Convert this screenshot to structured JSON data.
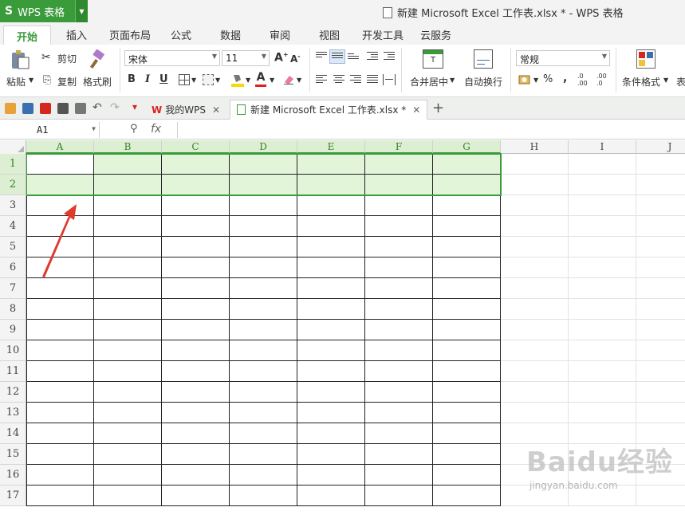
{
  "app": {
    "logo": "S",
    "name": "WPS 表格",
    "window_title": "新建 Microsoft Excel 工作表.xlsx * - WPS 表格"
  },
  "menu": {
    "tabs": [
      "开始",
      "插入",
      "页面布局",
      "公式",
      "数据",
      "审阅",
      "视图",
      "开发工具",
      "云服务"
    ],
    "active": "开始"
  },
  "ribbon": {
    "paste": "粘贴",
    "cut": "剪切",
    "copy": "复制",
    "format_painter": "格式刷",
    "font_name": "宋体",
    "font_size": "11",
    "bold": "B",
    "italic": "I",
    "underline": "U",
    "merge_center": "合并居中",
    "wrap_text": "自动换行",
    "number_format": "常规",
    "percent": "%",
    "comma": ",",
    "conditional_format": "条件格式",
    "more": "表"
  },
  "doc_tabs": [
    {
      "label": "我的WPS",
      "active": false
    },
    {
      "label": "新建 Microsoft Excel 工作表.xlsx *",
      "active": true
    }
  ],
  "formula_bar": {
    "name_box": "A1",
    "fx": "fx",
    "value": ""
  },
  "grid": {
    "columns": [
      "A",
      "B",
      "C",
      "D",
      "E",
      "F",
      "G",
      "H",
      "I",
      "J"
    ],
    "rows": [
      "1",
      "2",
      "3",
      "4",
      "5",
      "6",
      "7",
      "8",
      "9",
      "10",
      "11",
      "12",
      "13",
      "14",
      "15",
      "16",
      "17"
    ],
    "selected_range": "A1:G2",
    "accent_color": "#3a9b3a",
    "arrow_color": "#e03a2e"
  },
  "watermark": {
    "brand": "Baidu经验",
    "url": "jingyan.baidu.com"
  }
}
